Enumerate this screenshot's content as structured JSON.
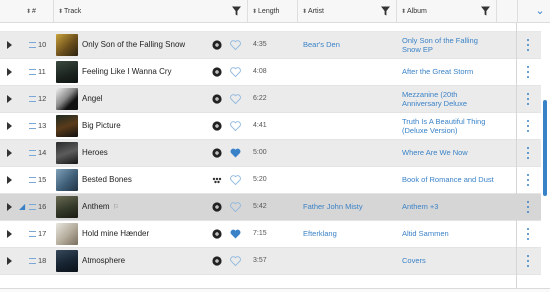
{
  "columns": {
    "number": "#",
    "track": "Track",
    "length": "Length",
    "artist": "Artist",
    "album": "Album"
  },
  "colors": {
    "accent": "#3a82c7",
    "row_alt": "#ebebeb",
    "row_selected": "#d6d6d6"
  },
  "tracks": [
    {
      "num": "10",
      "title": "Only Son of the Falling Snow",
      "tag": "",
      "length": "4:35",
      "artist": "Bear's Den",
      "album": "Only Son of the Falling Snow EP",
      "liked": false,
      "icon": "vinyl-icon"
    },
    {
      "num": "11",
      "title": "Feeling Like I Wanna Cry",
      "tag": "",
      "length": "4:08",
      "artist": "",
      "album": "After the Great Storm",
      "liked": false,
      "icon": "vinyl-icon"
    },
    {
      "num": "12",
      "title": "Angel",
      "tag": "",
      "length": "6:22",
      "artist": "",
      "album": "Mezzanine (20th Anniversary Deluxe",
      "liked": false,
      "icon": "vinyl-icon"
    },
    {
      "num": "13",
      "title": "Big Picture",
      "tag": "",
      "length": "4:41",
      "artist": "",
      "album": "Truth Is A Beautiful Thing (Deluxe Version)",
      "liked": false,
      "icon": "vinyl-icon"
    },
    {
      "num": "14",
      "title": "Heroes",
      "tag": "",
      "length": "5:00",
      "artist": "",
      "album": "Where Are We Now",
      "liked": true,
      "icon": "vinyl-icon"
    },
    {
      "num": "15",
      "title": "Bested Bones",
      "tag": "",
      "length": "5:20",
      "artist": "",
      "album": "Book of Romance and Dust",
      "liked": false,
      "icon": "dots-icon"
    },
    {
      "num": "16",
      "title": "Anthem",
      "tag": "⚐",
      "length": "5:42",
      "artist": "Father John Misty",
      "album": "Anthem +3",
      "liked": false,
      "icon": "vinyl-icon",
      "playing": true
    },
    {
      "num": "17",
      "title": "Hold mine Hænder",
      "tag": "",
      "length": "7:15",
      "artist": "Efterklang",
      "album": "Altid Sammen",
      "liked": true,
      "icon": "vinyl-icon"
    },
    {
      "num": "18",
      "title": "Atmosphere",
      "tag": "",
      "length": "3:57",
      "artist": "",
      "album": "Covers",
      "liked": false,
      "icon": "vinyl-icon"
    }
  ]
}
